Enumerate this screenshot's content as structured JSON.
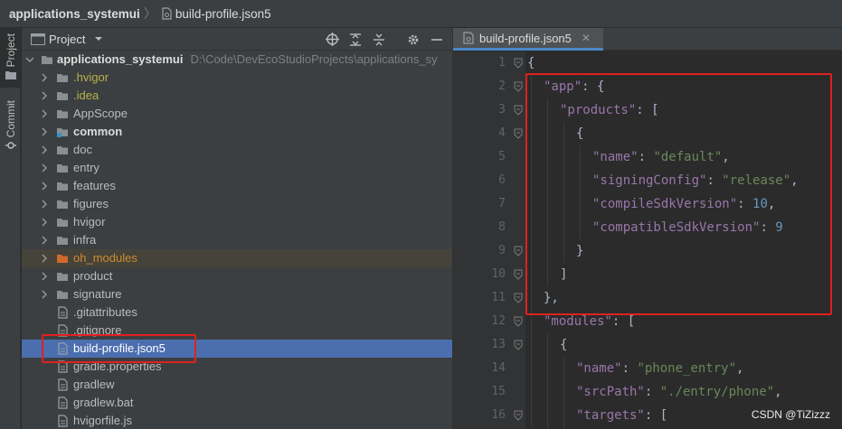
{
  "breadcrumb": {
    "root": "applications_systemui",
    "file": "build-profile.json5"
  },
  "toolstrip": {
    "project_label": "Project",
    "commit_label": "Commit"
  },
  "panel": {
    "title": "Project",
    "actions": [
      "locate-icon",
      "expand-all-icon",
      "collapse-all-icon",
      "gear-icon",
      "minimize-icon"
    ]
  },
  "tree": {
    "root": {
      "label": "applications_systemui",
      "path": "D:\\Code\\DevEcoStudioProjects\\applications_sy"
    },
    "items": [
      {
        "label": ".hvigor",
        "type": "folder"
      },
      {
        "label": ".idea",
        "type": "folder"
      },
      {
        "label": "AppScope",
        "type": "folder"
      },
      {
        "label": "common",
        "type": "module"
      },
      {
        "label": "doc",
        "type": "folder"
      },
      {
        "label": "entry",
        "type": "folder"
      },
      {
        "label": "features",
        "type": "folder"
      },
      {
        "label": "figures",
        "type": "folder"
      },
      {
        "label": "hvigor",
        "type": "folder"
      },
      {
        "label": "infra",
        "type": "folder"
      },
      {
        "label": "oh_modules",
        "type": "excluded-folder"
      },
      {
        "label": "product",
        "type": "folder"
      },
      {
        "label": "signature",
        "type": "folder"
      },
      {
        "label": ".gitattributes",
        "type": "file"
      },
      {
        "label": ".gitignore",
        "type": "file"
      },
      {
        "label": "build-profile.json5",
        "type": "file"
      },
      {
        "label": "gradle.properties",
        "type": "file"
      },
      {
        "label": "gradlew",
        "type": "file"
      },
      {
        "label": "gradlew.bat",
        "type": "file"
      },
      {
        "label": "hvigorfile.js",
        "type": "file"
      }
    ]
  },
  "editor": {
    "tab_label": "build-profile.json5",
    "line_numbers": [
      "1",
      "2",
      "3",
      "4",
      "5",
      "6",
      "7",
      "8",
      "9",
      "10",
      "11",
      "12",
      "13",
      "14",
      "15",
      "16"
    ],
    "code": {
      "l1": "{",
      "l2_key": "\"app\"",
      "l2_rest": ": {",
      "l3_key": "\"products\"",
      "l3_rest": ": [",
      "l4": "{",
      "l5_key": "\"name\"",
      "l5_sep": ": ",
      "l5_val": "\"default\"",
      "l5_end": ",",
      "l6_key": "\"signingConfig\"",
      "l6_sep": ": ",
      "l6_val": "\"release\"",
      "l6_end": ",",
      "l7_key": "\"compileSdkVersion\"",
      "l7_sep": ": ",
      "l7_val": "10",
      "l7_end": ",",
      "l8_key": "\"compatibleSdkVersion\"",
      "l8_sep": ": ",
      "l8_val": "9",
      "l9": "}",
      "l10": "]",
      "l11": "},",
      "l12_key": "\"modules\"",
      "l12_rest": ": [",
      "l13": "{",
      "l14_key": "\"name\"",
      "l14_sep": ": ",
      "l14_val": "\"phone_entry\"",
      "l14_end": ",",
      "l15_key": "\"srcPath\"",
      "l15_sep": ": ",
      "l15_val": "\"./entry/phone\"",
      "l15_end": ",",
      "l16_key": "\"targets\"",
      "l16_rest": ": ["
    }
  },
  "watermark": "CSDN @TiZizzz",
  "colors": {
    "accent": "#4b6eaf",
    "highlight_box": "#e02020",
    "string": "#6a8759",
    "key": "#9876aa",
    "number": "#6897bb"
  }
}
